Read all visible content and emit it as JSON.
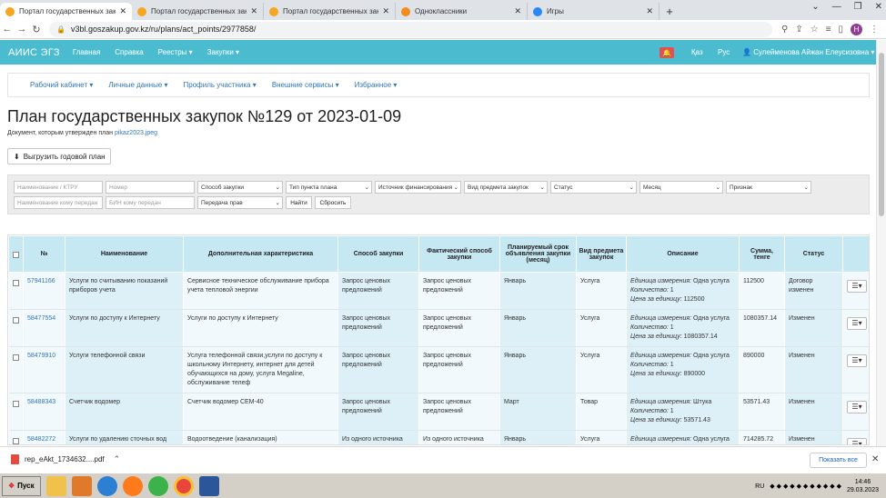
{
  "browser": {
    "tabs": [
      {
        "title": "Портал государственных закупок",
        "color": "#f5a623",
        "active": true
      },
      {
        "title": "Портал государственных закупок",
        "color": "#f5a623",
        "active": false
      },
      {
        "title": "Портал государственных закупок",
        "color": "#f5a623",
        "active": false
      },
      {
        "title": "Одноклассники",
        "color": "#f28c1c",
        "active": false
      },
      {
        "title": "Игры",
        "color": "#2787f5",
        "active": false
      }
    ],
    "url": "v3bl.goszakup.gov.kz/ru/plans/act_points/2977858/",
    "profile_initial": "Н"
  },
  "appbar": {
    "brand": "АИИС ЭГЗ",
    "menu": [
      "Главная",
      "Справка",
      "Реестры ▾",
      "Закупки ▾"
    ],
    "lang_kz": "Қаз",
    "lang_ru": "Рус",
    "user": "Сулейменова Айжан Елеусизовна ▾"
  },
  "subnav": [
    "Рабочий кабинет ▾",
    "Личные данные ▾",
    "Профиль участника ▾",
    "Внешние сервисы ▾",
    "Избранное ▾"
  ],
  "page": {
    "title": "План государственных закупок №129 от 2023-01-09",
    "doc_text": "Документ, которым утвержден план",
    "doc_link": "pikaz2023.jpeg",
    "export_button": "Выгрузить годовой план"
  },
  "filters": {
    "name_placeholder": "Наименование / КТРУ",
    "number_placeholder": "Номер",
    "method": "Способ закупки",
    "point_type": "Тип пункта плана",
    "funding": "Источник финансирования",
    "subject": "Вид предмета закупок",
    "status": "Статус",
    "month": "Месяц",
    "sign": "Признак",
    "transfer_name_placeholder": "Наименование кому передан",
    "bin_placeholder": "БИН кому передан",
    "rights": "Передача прав",
    "find": "Найти",
    "reset": "Сбросить"
  },
  "table": {
    "headers": [
      "№",
      "Наименование",
      "Дополнительная характеристика",
      "Способ закупки",
      "Фактический способ закупки",
      "Планируемый срок объявления закупки (месяц)",
      "Вид предмета закупок",
      "Описание",
      "Сумма, тенге",
      "Статус"
    ],
    "desc_labels": {
      "unit": "Единица измерения:",
      "qty": "Количество:",
      "price": "Цена за единицу:"
    },
    "rows": [
      {
        "num": "57941166",
        "name": "Услуги по считыванию показаний приборов учета",
        "extra": "Сервисное техническое обслуживание прибора учета тепловой энергии",
        "method": "Запрос ценовых предложений",
        "fact": "Запрос ценовых предложений",
        "month": "Январь",
        "kind": "Услуга",
        "unit": "Одна услуга",
        "qty": "1",
        "price": "112500",
        "sum": "112500",
        "status": "Договор изменен"
      },
      {
        "num": "58477554",
        "name": "Услуги по доступу к Интернету",
        "extra": "Услуги по доступу к Интернету",
        "method": "Запрос ценовых предложений",
        "fact": "Запрос ценовых предложений",
        "month": "Январь",
        "kind": "Услуга",
        "unit": "Одна услуга",
        "qty": "1",
        "price": "1080357.14",
        "sum": "1080357.14",
        "status": "Изменен"
      },
      {
        "num": "58479910",
        "name": "Услуги телефонной связи",
        "extra": "Услуга телефонной связи,услуги по доступу к школьному Интернету, интернет для детей обучающихся на дому, услуга Megaline, обслуживание телеф",
        "method": "Запрос ценовых предложений",
        "fact": "Запрос ценовых предложений",
        "month": "Январь",
        "kind": "Услуга",
        "unit": "Одна услуга",
        "qty": "1",
        "price": "890000",
        "sum": "890000",
        "status": "Изменен"
      },
      {
        "num": "58488343",
        "name": "Счетчик водомер",
        "extra": "Счетчик водомер СЕМ-40",
        "method": "Запрос ценовых предложений",
        "fact": "Запрос ценовых предложений",
        "month": "Март",
        "kind": "Товар",
        "unit": "Штука",
        "qty": "1",
        "price": "53571.43",
        "sum": "53571.43",
        "status": "Изменен"
      },
      {
        "num": "58482272",
        "name": "Услуги по удалению сточных вод",
        "extra": "Водоотведение (канализация)",
        "method": "Из одного источника путем прямого",
        "fact": "Из одного источника путем прямого",
        "month": "Январь",
        "kind": "Услуга",
        "unit": "Одна услуга",
        "qty": "1",
        "price": "714285.72",
        "sum": "714285.72",
        "status": "Изменен"
      }
    ]
  },
  "download": {
    "file": "rep_eAkt_1734632....pdf",
    "show_all": "Показать все"
  },
  "taskbar": {
    "start": "Пуск",
    "lang": "RU",
    "time": "14:46",
    "date": "29.03.2023"
  }
}
